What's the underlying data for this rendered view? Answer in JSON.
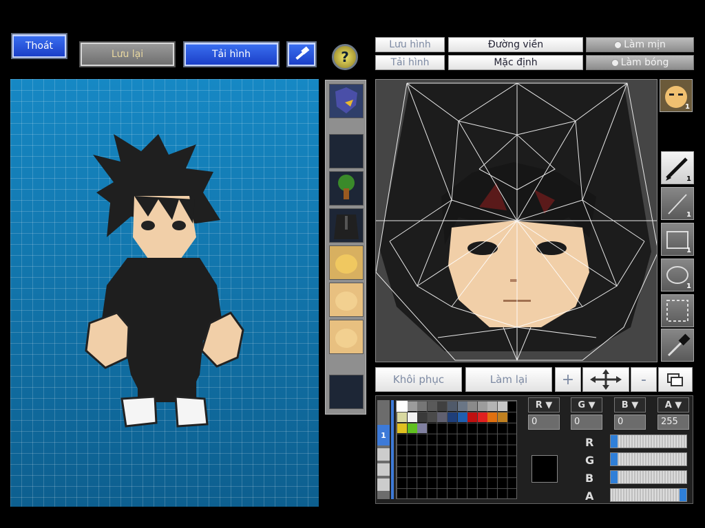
{
  "top_left": {
    "exit_label": "Thoát",
    "save_label": "Lưu lại",
    "load_label": "Tải hình"
  },
  "editor_toolbar": {
    "save_img_label": "Lưu hình",
    "load_img_label": "Tải hình",
    "outline_label": "Đường viền",
    "default_label": "Mặc định",
    "smooth_label": "Làm mịn",
    "shade_label": "Làm bóng"
  },
  "bottom_controls": {
    "restore_label": "Khôi phục",
    "redo_label": "Làm lại",
    "plus_label": "+",
    "minus_label": "-"
  },
  "tools": {
    "pen_num": "1",
    "line_num": "1",
    "rect_num": "1",
    "ellipse_num": "1",
    "face_layer_num": "1"
  },
  "palette": {
    "page_tab": "1",
    "channels": {
      "r": "R",
      "g": "G",
      "b": "B",
      "a": "A"
    },
    "values": {
      "r": "0",
      "g": "0",
      "b": "0",
      "a": "255"
    },
    "slider_levels": {
      "r": 0,
      "g": 0,
      "b": 0,
      "a": 1.0
    },
    "swatch_colors": [
      "#ffffff",
      "#9b9b9b",
      "#767676",
      "#5a5a5a",
      "#404040",
      "#505a6a",
      "#6a7686",
      "#8a8a8a",
      "#9c9c9c",
      "#b4b4b4",
      "#c8c8c8",
      "#d8d8a0",
      "#f2f2f2",
      "#3a3a3a",
      "#4a4a4a",
      "#606070",
      "#1f3f7a",
      "#1f5fb0",
      "#c01010",
      "#e02020",
      "#e07010",
      "#c08020",
      "#e0c020",
      "#60c020",
      "#8080a0"
    ],
    "current_color": "#000000"
  },
  "colors": {
    "accent_blue": "#1b3fc8",
    "canvas_blue": "#1f8dbe",
    "slider_blue": "#2f7fd8"
  }
}
